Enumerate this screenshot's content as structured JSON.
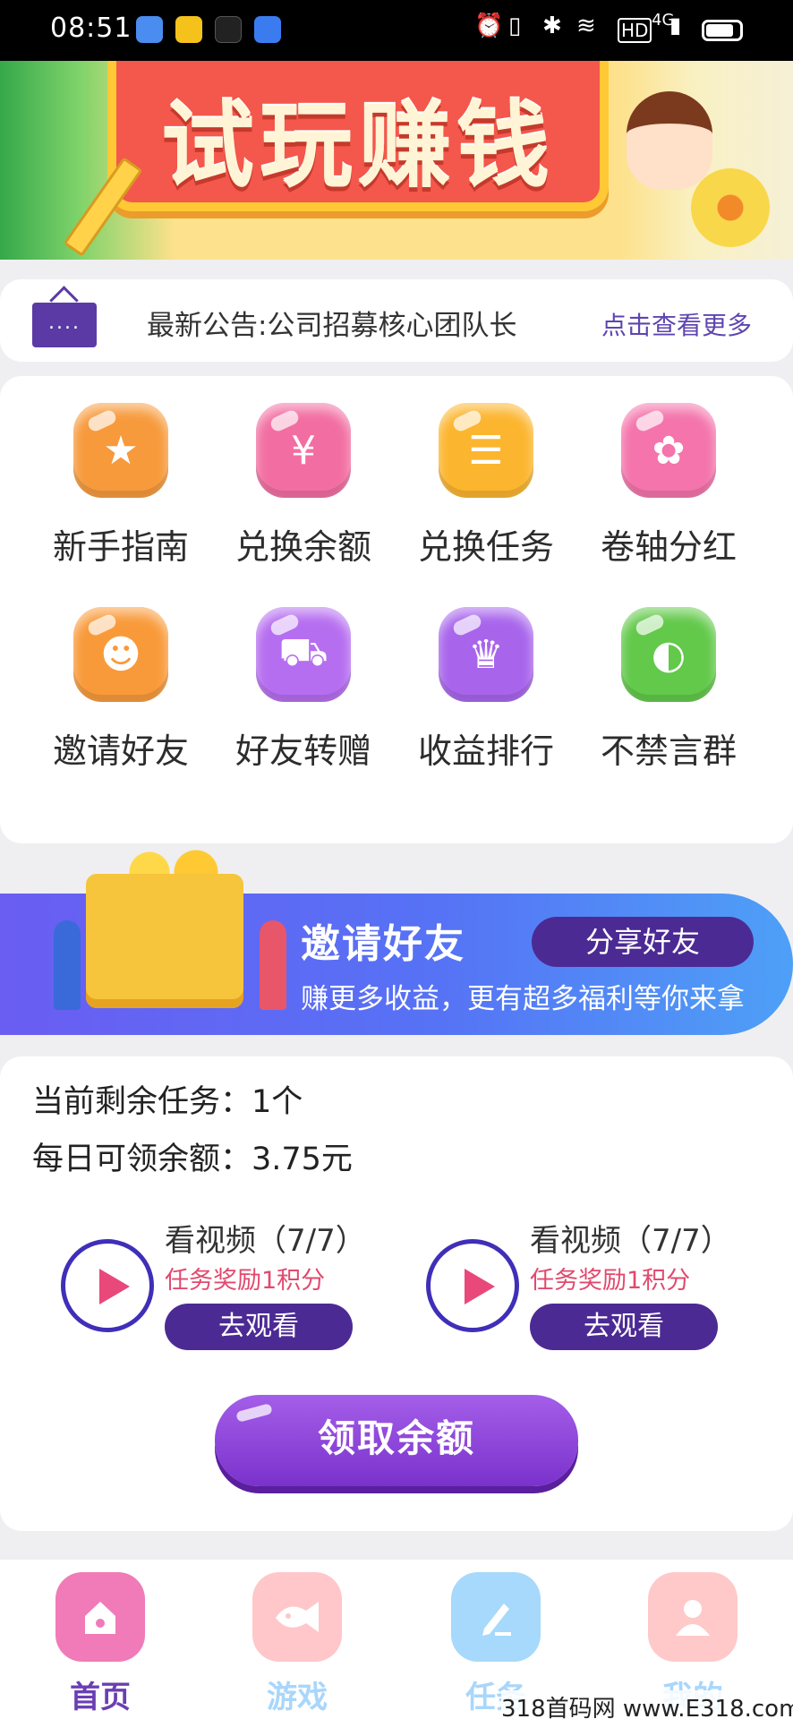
{
  "status_bar": {
    "time": "08:51",
    "network": "4G"
  },
  "banner": {
    "title": "试玩赚钱"
  },
  "notice": {
    "icon_text": "....",
    "text": "最新公告:公司招募核心团队长",
    "more": "点击查看更多"
  },
  "menu": [
    {
      "label": "新手指南",
      "icon": "guide-icon",
      "color": "#f79a3c"
    },
    {
      "label": "兑换余额",
      "icon": "exchange-balance-icon",
      "color": "#f26ea2"
    },
    {
      "label": "兑换任务",
      "icon": "exchange-task-icon",
      "color": "#fcb52e"
    },
    {
      "label": "卷轴分红",
      "icon": "piggy-bank-icon",
      "color": "#f474ab"
    },
    {
      "label": "邀请好友",
      "icon": "invite-friends-icon",
      "color": "#f99a3a"
    },
    {
      "label": "好友转赠",
      "icon": "cart-icon",
      "color": "#b66ef0"
    },
    {
      "label": "收益排行",
      "icon": "trophy-icon",
      "color": "#a865ec"
    },
    {
      "label": "不禁言群",
      "icon": "planet-icon",
      "color": "#62c94a"
    }
  ],
  "invite": {
    "title": "邀请好友",
    "subtitle": "赚更多收益，更有超多福利等你来拿",
    "button": "分享好友"
  },
  "tasks": {
    "remaining": "当前剩余任务：1个",
    "daily": "每日可领余额：3.75元",
    "videos": [
      {
        "title": "看视频（7/7）",
        "reward": "任务奖励1积分",
        "button": "去观看"
      },
      {
        "title": "看视频（7/7）",
        "reward": "任务奖励1积分",
        "button": "去观看"
      }
    ],
    "claim_button": "领取余额"
  },
  "tabbar": [
    {
      "label": "首页",
      "icon": "home-icon",
      "color": "#f07bb8",
      "text_color": "#6a3fb2",
      "active": true
    },
    {
      "label": "游戏",
      "icon": "game-icon",
      "color": "#ffc7c9",
      "text_color": "#a9d6fb",
      "active": false
    },
    {
      "label": "任务",
      "icon": "task-pen-icon",
      "color": "#a6d9fb",
      "text_color": "#a9d6fb",
      "active": false
    },
    {
      "label": "我的",
      "icon": "profile-icon",
      "color": "#ffc9c9",
      "text_color": "#a9d6fb",
      "active": false
    }
  ],
  "watermark": "318首码网 www.E318.com"
}
